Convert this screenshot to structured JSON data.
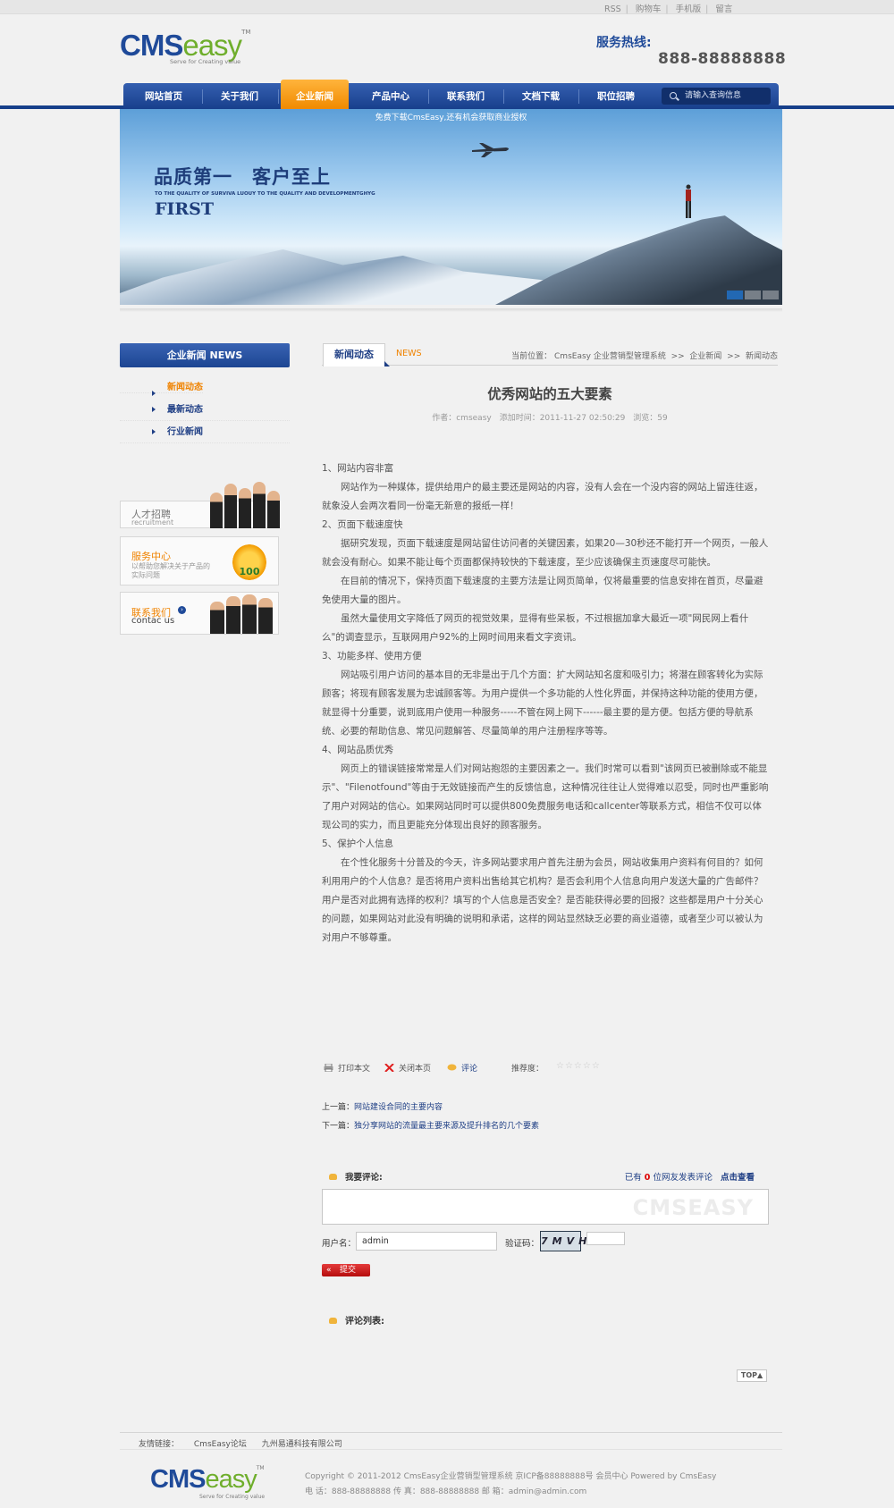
{
  "toplinks": [
    "RSS",
    "购物车",
    "手机版",
    "留言"
  ],
  "logo": {
    "cms": "CMS",
    "easy": "easy",
    "tm": "TM",
    "tagline": "Serve for Creating value"
  },
  "hotline": {
    "label": "服务热线:",
    "number": "888-88888888"
  },
  "nav": {
    "items": [
      "网站首页",
      "关于我们",
      "企业新闻",
      "产品中心",
      "联系我们",
      "文档下载",
      "职位招聘"
    ],
    "active_index": 2,
    "search_placeholder": "请输入查询信息"
  },
  "banner": {
    "notice": "免费下载CmsEasy,还有机会获取商业授权",
    "slogan": "品质第一　客户至上",
    "sub": "TO THE QUALITY OF SURVIVA LUOUY TO THE QUALITY AND DEVELOPMENTGHYG",
    "first": "FIRST"
  },
  "sidebar": {
    "title": "企业新闻  NEWS",
    "items": [
      "新闻动态",
      "最新动态",
      "行业新闻"
    ],
    "active_index": 0,
    "promos": [
      {
        "title": "人才招聘",
        "sub": "recruitment"
      },
      {
        "title": "服务中心",
        "sub": "以帮助您解决关于产品的实际问题",
        "badge": "100"
      },
      {
        "title": "联系我们",
        "sub": "contac us"
      }
    ]
  },
  "tabs": {
    "active": "新闻动态",
    "english": "NEWS"
  },
  "breadcrumb": {
    "label": "当前位置：",
    "path": [
      "CmsEasy 企业营销型管理系统",
      "企业新闻",
      "新闻动态"
    ],
    "sep": ">>"
  },
  "article": {
    "title": "优秀网站的五大要素",
    "meta": "作者：cmseasy　添加时间：2011-11-27 02:50:29　浏览：59",
    "paragraphs": [
      {
        "text": "1、网站内容非富",
        "indent": false
      },
      {
        "text": "网站作为一种媒体，提供给用户的最主要还是网站的内容，没有人会在一个没内容的网站上留连往返，就象没人会两次看同一份毫无新意的报纸一样！",
        "indent": true
      },
      {
        "text": "2、页面下载速度快",
        "indent": false
      },
      {
        "text": "据研究发现，页面下载速度是网站留住访问者的关键因素，如果20—30秒还不能打开一个网页，一般人就会没有耐心。如果不能让每个页面都保持较快的下载速度，至少应该确保主页速度尽可能快。",
        "indent": true
      },
      {
        "text": "在目前的情况下，保持页面下载速度的主要方法是让网页简单，仅将最重要的信息安排在首页，尽量避免使用大量的图片。",
        "indent": true
      },
      {
        "text": "虽然大量使用文字降低了网页的视觉效果，显得有些呆板，不过根据加拿大最近一项\"网民网上看什么\"的调查显示，互联网用户92%的上网时间用来看文字资讯。",
        "indent": true
      },
      {
        "text": "3、功能多样、使用方便",
        "indent": false
      },
      {
        "text": "网站吸引用户访问的基本目的无非是出于几个方面：扩大网站知名度和吸引力；将潜在顾客转化为实际顾客；将现有顾客发展为忠诚顾客等。为用户提供一个多功能的人性化界面，并保持这种功能的使用方便，就显得十分重要，说到底用户使用一种服务-----不管在网上网下------最主要的是方便。包括方便的导航系统、必要的帮助信息、常见问题解答、尽量简单的用户注册程序等等。",
        "indent": true
      },
      {
        "text": "4、网站品质优秀",
        "indent": false
      },
      {
        "text": "网页上的错误链接常常是人们对网站抱怨的主要因素之一。我们时常可以看到\"该网页已被删除或不能显示\"、\"Filenotfound\"等由于无效链接而产生的反馈信息，这种情况往往让人觉得难以忍受，同时也严重影响了用户对网站的信心。如果网站同时可以提供800免费服务电话和callcenter等联系方式，相信不仅可以体现公司的实力，而且更能充分体现出良好的顾客服务。",
        "indent": true
      },
      {
        "text": "5、保护个人信息",
        "indent": false
      },
      {
        "text": "在个性化服务十分普及的今天，许多网站要求用户首先注册为会员，网站收集用户资料有何目的？如何利用用户的个人信息？是否将用户资料出售给其它机构？是否会利用个人信息向用户发送大量的广告邮件？用户是否对此拥有选择的权利？填写的个人信息是否安全？是否能获得必要的回报？这些都是用户十分关心的问题，如果网站对此没有明确的说明和承诺，这样的网站显然缺乏必要的商业道德，或者至少可以被认为对用户不够尊重。",
        "indent": true
      }
    ]
  },
  "tools": {
    "print": "打印本文",
    "close": "关闭本页",
    "comment": "评论",
    "rating_label": "推荐度：",
    "stars": "☆☆☆☆☆",
    "rating": 0
  },
  "prev": {
    "label": "上一篇：",
    "title": "网站建设合同的主要内容"
  },
  "next": {
    "label": "下一篇：",
    "title": "独分享网站的流量最主要来源及提升排名的几个要素"
  },
  "comment": {
    "heading": "我要评论:",
    "count_prefix": "已有",
    "count": "0",
    "count_suffix": "位网友发表评论",
    "view_label": "点击查看",
    "watermark": "CMSEASY",
    "user_label": "用户名：",
    "user_value": "admin",
    "code_label": "验证码：",
    "captcha_text": "7MVH",
    "submit_label": "提交",
    "list_heading": "评论列表:"
  },
  "totop": "TOP▲",
  "footer": {
    "friends_label": "友情链接：",
    "friends": [
      "CmsEasy论坛",
      "九州易通科技有限公司"
    ],
    "copyright": "Copyright © 2011-2012  CmsEasy企业营销型管理系统  京ICP备88888888号  会员中心  Powered by CmsEasy",
    "contact": "电 话：888-88888888  传 真：888-88888888  邮 箱：admin@admin.com"
  },
  "colors": {
    "brand_blue": "#1f4a99",
    "nav_active": "#f08a00",
    "link": "#1f3f85",
    "submit": "#c81d1d"
  }
}
